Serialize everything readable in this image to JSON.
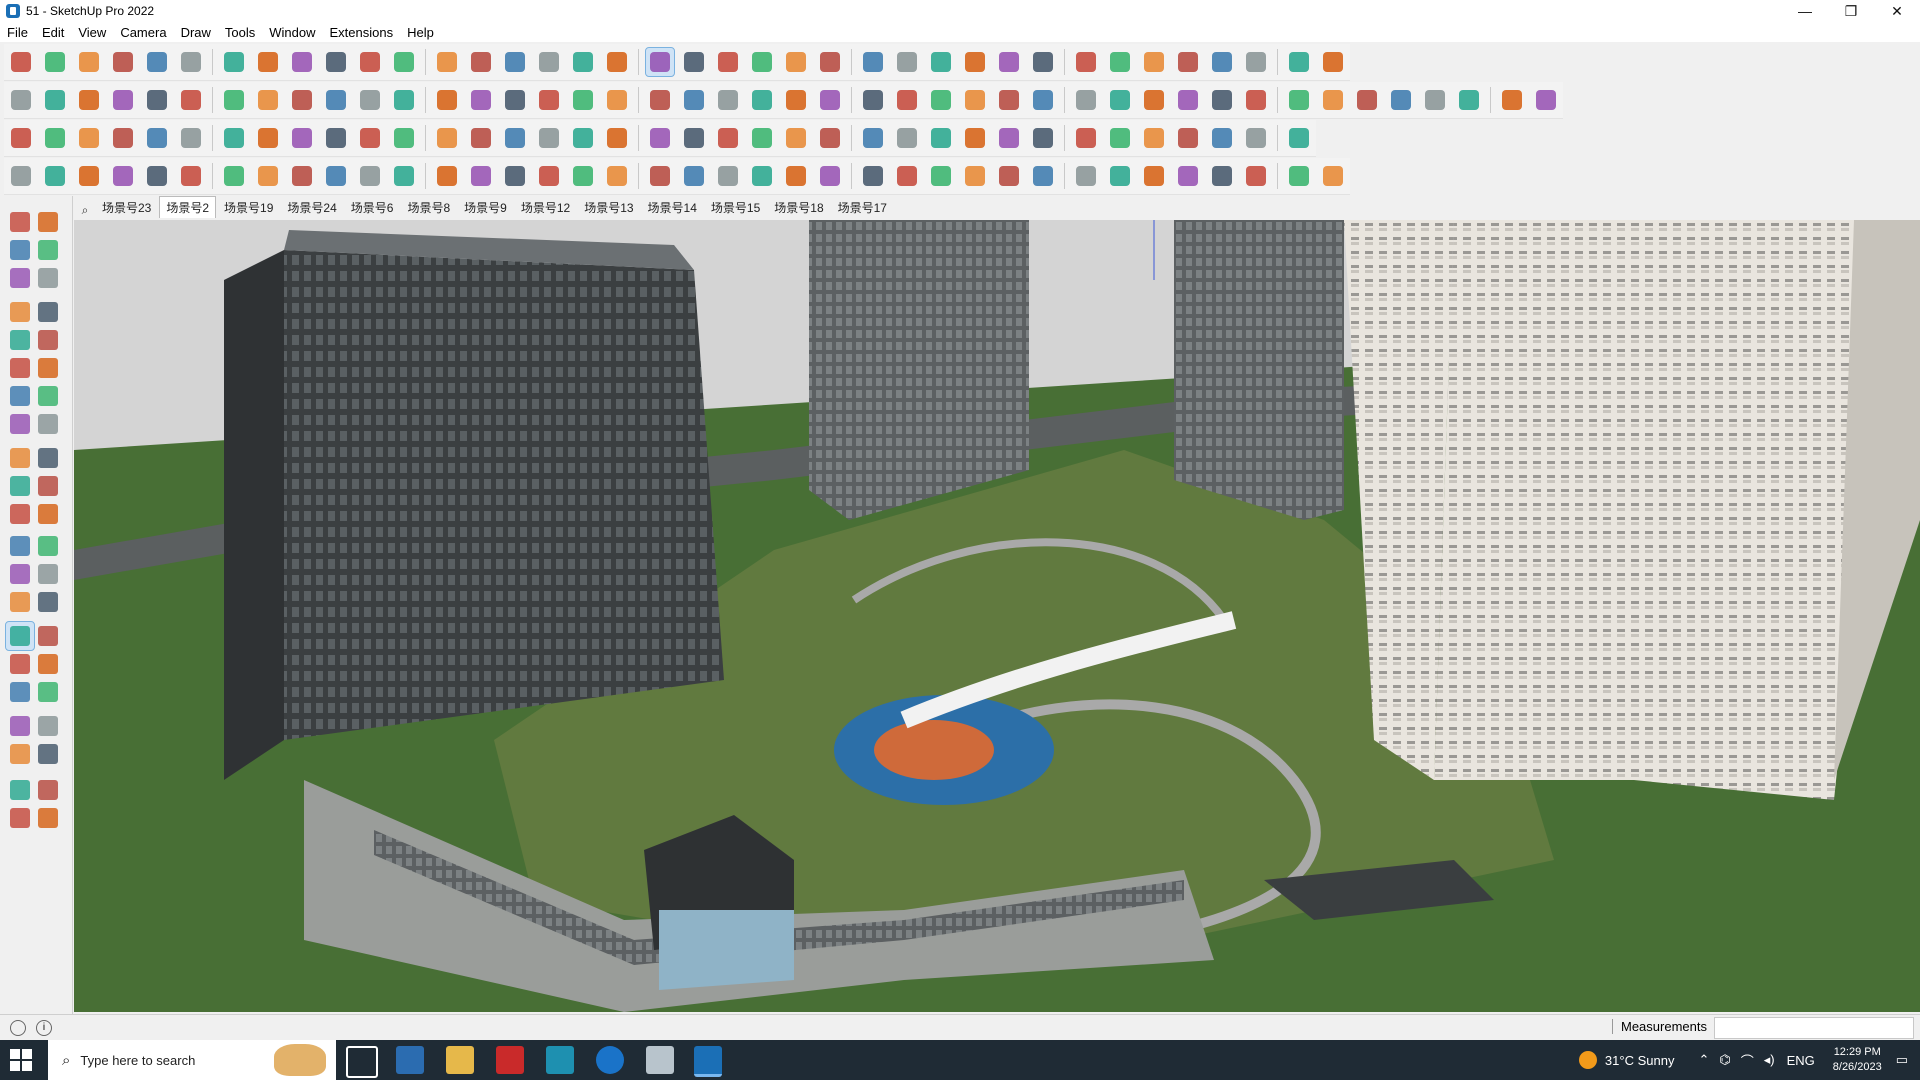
{
  "window": {
    "title": "51 - SketchUp Pro 2022",
    "controls": [
      "—",
      "❐",
      "✕"
    ]
  },
  "menu": [
    "File",
    "Edit",
    "View",
    "Camera",
    "Draw",
    "Tools",
    "Window",
    "Extensions",
    "Help"
  ],
  "scenes": {
    "tabs": [
      "场景号23",
      "场景号2",
      "场景号19",
      "场景号24",
      "场景号6",
      "场景号8",
      "场景号9",
      "场景号12",
      "场景号13",
      "场景号14",
      "场景号15",
      "场景号18",
      "场景号17"
    ],
    "active_index": 1
  },
  "status": {
    "measurements_label": "Measurements",
    "measurements_value": ""
  },
  "taskbar": {
    "search_placeholder": "Type here to search",
    "weather": "31°C  Sunny",
    "language": "ENG",
    "time": "12:29 PM",
    "date": "8/26/2023"
  },
  "colors": {
    "sky": "#d9d9d9",
    "lawn": "#5f7a3d",
    "building_dark": "#3e4345",
    "building_light": "#ece8e1",
    "accent_blue": "#2c6fa8",
    "toolbar_bg": "#f3f3f3"
  }
}
